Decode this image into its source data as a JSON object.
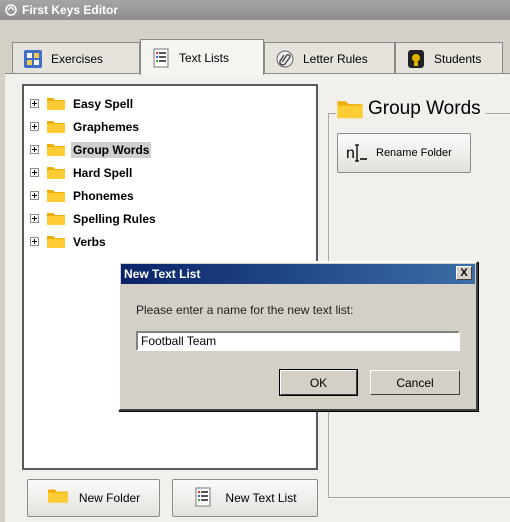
{
  "window": {
    "title": "First Keys Editor"
  },
  "tabs": [
    {
      "label": "Exercises",
      "icon": "grid-icon",
      "active": false
    },
    {
      "label": "Text Lists",
      "icon": "document-list-icon",
      "active": true
    },
    {
      "label": "Letter Rules",
      "icon": "paperclip-icon",
      "active": false
    },
    {
      "label": "Students",
      "icon": "student-icon",
      "active": false
    }
  ],
  "tree": {
    "items": [
      {
        "label": "Easy Spell",
        "selected": false
      },
      {
        "label": "Graphemes",
        "selected": false
      },
      {
        "label": "Group Words",
        "selected": true
      },
      {
        "label": "Hard Spell",
        "selected": false
      },
      {
        "label": "Phonemes",
        "selected": false
      },
      {
        "label": "Spelling Rules",
        "selected": false
      },
      {
        "label": "Verbs",
        "selected": false
      }
    ]
  },
  "details": {
    "title": "Group Words",
    "rename_button": "Rename Folder"
  },
  "bottom": {
    "new_folder": "New Folder",
    "new_text_list": "New Text List"
  },
  "dialog": {
    "title": "New Text List",
    "close_glyph": "X",
    "prompt": "Please enter a name for the new text list:",
    "input_value": "Football Team",
    "ok": "OK",
    "cancel": "Cancel"
  },
  "colors": {
    "folder": "#f5b800",
    "dialog_title": "#0a246a",
    "selection": "#cfcfcf"
  }
}
